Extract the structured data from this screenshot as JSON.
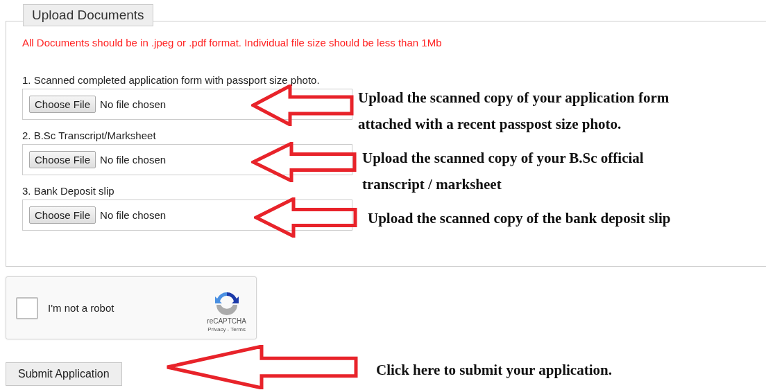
{
  "legend": "Upload Documents",
  "notice": "All Documents should be in .jpeg or .pdf format. Individual file size should be less than 1Mb",
  "documents": [
    {
      "label": "1. Scanned completed application form with passport size photo.",
      "button": "Choose File",
      "status": "No file chosen"
    },
    {
      "label": "2. B.Sc Transcript/Marksheet",
      "button": "Choose File",
      "status": "No file chosen"
    },
    {
      "label": "3. Bank Deposit slip",
      "button": "Choose File",
      "status": "No file chosen"
    }
  ],
  "captcha": {
    "label": "I'm not a robot",
    "checked": false,
    "brand": "reCAPTCHA",
    "privacy": "Privacy",
    "separator": "-",
    "terms": "Terms"
  },
  "submit": "Submit Application",
  "annotations": [
    {
      "text": "Upload the scanned copy of your application form attached with a recent passpost size photo."
    },
    {
      "text": "Upload the scanned copy of your B.Sc official transcript / marksheet"
    },
    {
      "text": "Upload the scanned copy of the bank deposit slip"
    },
    {
      "text": "Click here to submit your application."
    }
  ]
}
